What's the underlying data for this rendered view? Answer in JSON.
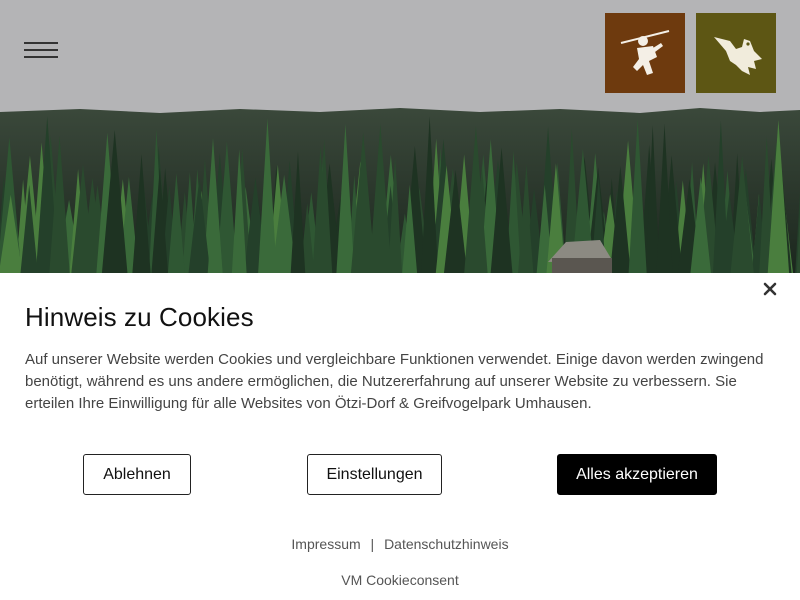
{
  "site": {
    "colors": {
      "header_bg": "#b4b4b6",
      "logo_oetzi_bg": "#6e3a0e",
      "logo_raptor_bg": "#5d5614"
    },
    "logos": [
      {
        "icon": "hunter-figure-icon"
      },
      {
        "icon": "eagle-icon"
      }
    ]
  },
  "cookie_banner": {
    "title": "Hinweis zu Cookies",
    "body": "Auf unserer Website werden Cookies und vergleichbare Funktionen verwendet. Einige davon werden zwingend benötigt, während es uns andere ermöglichen, die Nutzererfahrung auf unserer Website zu verbessern. Sie erteilen Ihre Einwilligung für alle Websites von Ötzi-Dorf & Greifvogelpark Umhausen.",
    "buttons": {
      "decline": "Ablehnen",
      "settings": "Einstellungen",
      "accept": "Alles akzeptieren"
    },
    "links": {
      "imprint": "Impressum",
      "separator": "|",
      "privacy": "Datenschutzhinweis"
    },
    "credit": "VM Cookieconsent",
    "close_icon": "close-icon",
    "accent_color": "#000000"
  }
}
